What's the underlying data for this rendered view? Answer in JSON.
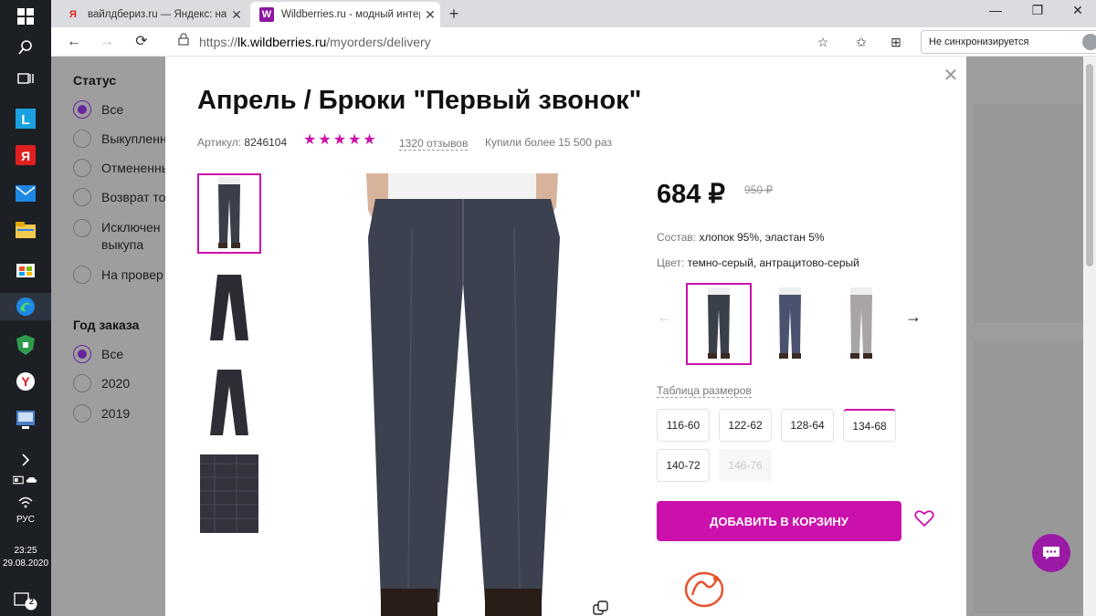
{
  "taskbar": {
    "lang": "РУС",
    "time": "23:25",
    "date": "29.08.2020",
    "notif_count": "2"
  },
  "browser": {
    "tabs": [
      {
        "title": "вайлдбериз.ru — Яндекс: нашлось",
        "favicon": "yandex-icon"
      },
      {
        "title": "Wildberries.ru - модный интернет",
        "favicon": "wildberries-icon"
      }
    ],
    "url_scheme": "https://",
    "url_host": "lk.wildberries.ru",
    "url_path": "/myorders/delivery",
    "sync_label": "Не синхронизируется"
  },
  "filters": {
    "status_title": "Статус",
    "status_options": [
      "Все",
      "Выкупленн",
      "Отмененны",
      "Возврат то",
      "Исключен",
      "выкупа",
      "На провер"
    ],
    "year_title": "Год заказа",
    "year_options": [
      "Все",
      "2020",
      "2019"
    ]
  },
  "product": {
    "title": "Апрель / Брюки \"Первый звонок\"",
    "article_label": "Артикул:",
    "article": "8246104",
    "rating_stars": 5,
    "reviews": "1320 отзывов",
    "bought": "Купили более 15 500 раз",
    "price": "684 ₽",
    "old_price": "950 ₽",
    "composition_label": "Состав:",
    "composition": "хлопок 95%, эластан 5%",
    "color_label": "Цвет:",
    "color": "темно-серый, антрацитово-серый",
    "size_table_label": "Таблица размеров",
    "sizes": [
      {
        "label": "116-60",
        "state": "normal"
      },
      {
        "label": "122-62",
        "state": "normal"
      },
      {
        "label": "128-64",
        "state": "normal"
      },
      {
        "label": "134-68",
        "state": "selected"
      },
      {
        "label": "140-72",
        "state": "normal"
      },
      {
        "label": "146-76",
        "state": "disabled"
      }
    ],
    "add_to_cart": "ДОБАВИТЬ В КОРЗИНУ"
  },
  "colors": {
    "accent": "#cb11ab",
    "radio": "#a73afd",
    "chat": "#9b1aa5"
  }
}
